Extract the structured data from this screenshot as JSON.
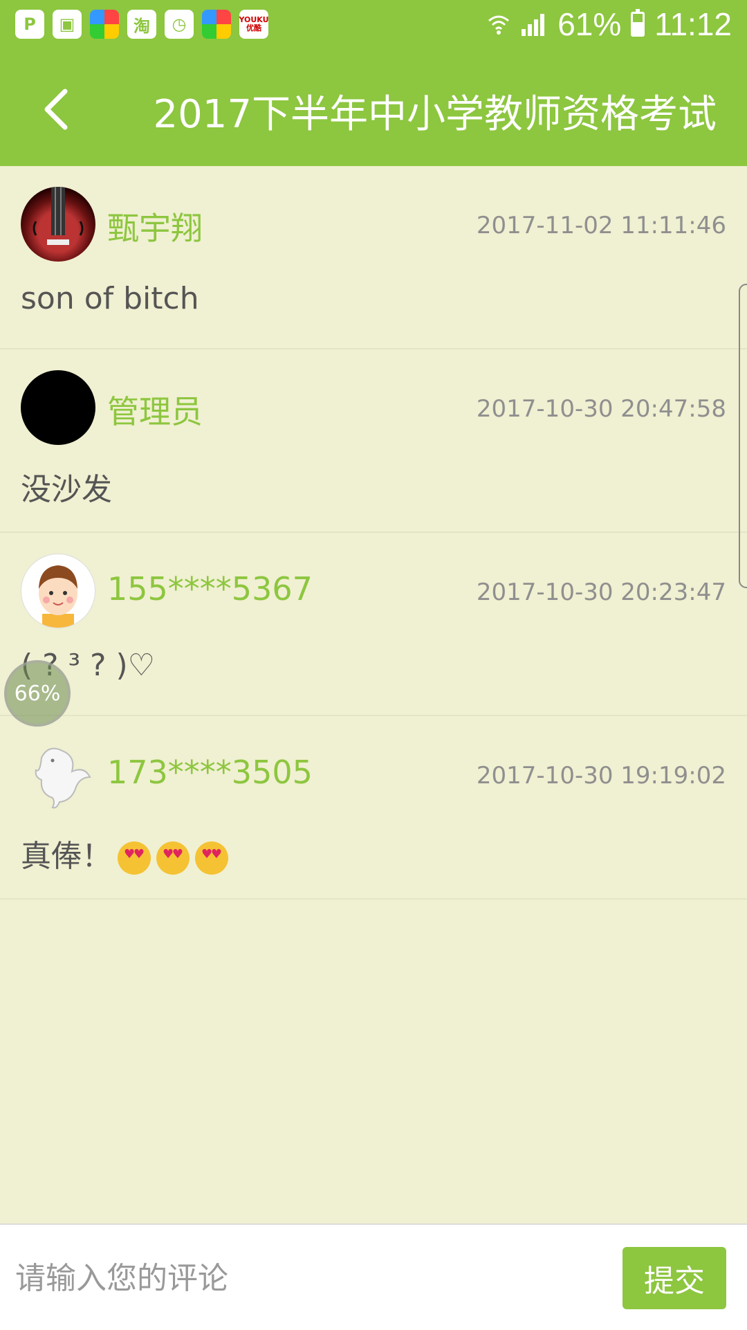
{
  "status_bar": {
    "apps": [
      "P",
      "",
      "",
      "淘",
      "",
      "",
      "YOUKU 优酷"
    ],
    "battery": "61%",
    "time": "11:12"
  },
  "header": {
    "title": "2017下半年中小学教师资格考试",
    "back_icon": "chevron-left-icon"
  },
  "comments": [
    {
      "username": "甄宇翔",
      "time": "2017-11-02 11:11:46",
      "text": "son of bitch",
      "avatar": "violin"
    },
    {
      "username": "管理员",
      "time": "2017-10-30 20:47:58",
      "text": "没沙发",
      "avatar": "black"
    },
    {
      "username": "155****5367",
      "time": "2017-10-30 20:23:47",
      "text": "( ? ³ ? )♡",
      "avatar": "boy"
    },
    {
      "username": "173****3505",
      "time": "2017-10-30 19:19:02",
      "text": "真俸！",
      "avatar": "dragon"
    }
  ],
  "floating": {
    "progress": "66%"
  },
  "input": {
    "placeholder": "请输入您的评论",
    "value": ""
  },
  "submit": {
    "label": "提交"
  },
  "colors": {
    "accent": "#8DC63F",
    "background": "#F0F0D2"
  }
}
